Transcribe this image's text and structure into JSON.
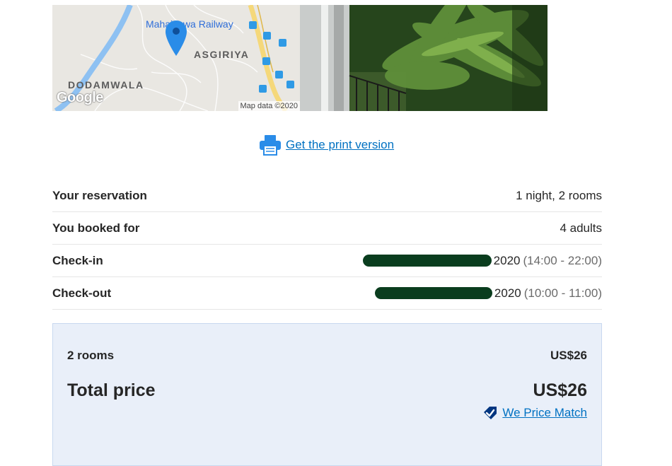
{
  "map": {
    "railway_label": "Mahaiyawa Railway",
    "area_label_1": "ASGIRIYA",
    "area_label_2": "DODAMWALA",
    "logo_text": "Google",
    "attribution": "Map data ©2020"
  },
  "print": {
    "link_label": "Get the print version",
    "icon": "printer-icon"
  },
  "reservation": {
    "rows": [
      {
        "label": "Your reservation",
        "value": "1 night, 2 rooms"
      },
      {
        "label": "You booked for",
        "value": "4 adults"
      },
      {
        "label": "Check-in",
        "date_year": "2020",
        "time": "(14:00 - 22:00)"
      },
      {
        "label": "Check-out",
        "date_year": "2020",
        "time": "(10:00 - 11:00)"
      }
    ]
  },
  "price": {
    "rooms_label": "2 rooms",
    "rooms_value": "US$26",
    "total_label": "Total price",
    "total_value": "US$26",
    "price_match_label": " We Price Match",
    "price_match_icon": "price-match-tag-icon"
  },
  "colors": {
    "link": "#0071c2",
    "price_box_bg": "#e9eff9",
    "redaction": "#0a3d1e"
  }
}
